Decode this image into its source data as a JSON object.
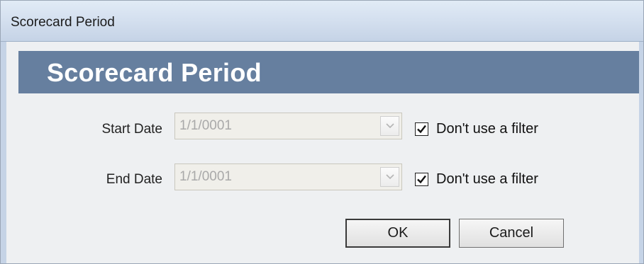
{
  "window": {
    "title": "Scorecard Period"
  },
  "header": {
    "title": "Scorecard Period"
  },
  "start_date": {
    "label": "Start Date",
    "value": "1/1/0001",
    "filter_label": "Don't use a filter",
    "filter_checked": true
  },
  "end_date": {
    "label": "End Date",
    "value": "1/1/0001",
    "filter_label": "Don't use a filter",
    "filter_checked": true
  },
  "buttons": {
    "ok_label": "OK",
    "cancel_label": "Cancel"
  },
  "colors": {
    "header_band": "#667f9f",
    "title_bar": "#d2deee",
    "client_background": "#eef0f2",
    "disabled_text": "#a9a9a9"
  },
  "icons": {
    "dropdown": "chevron-down-icon",
    "checkbox": "checkmark-icon"
  }
}
